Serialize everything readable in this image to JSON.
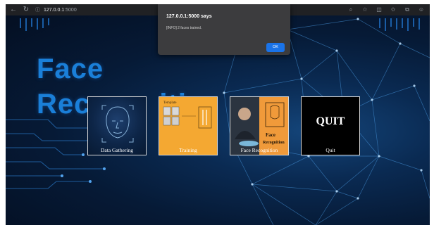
{
  "browser": {
    "url_host": "127.0.0.1",
    "url_port": ":5000",
    "nav": {
      "back": "←",
      "reload": "↻",
      "info": "ⓘ"
    }
  },
  "page": {
    "title_line1": "Face",
    "title_line2": "Rec",
    "title_line2_tail": "iti",
    "cards": [
      {
        "label": "Data Gathering"
      },
      {
        "label": "Training",
        "tag": "Template"
      },
      {
        "label": "Face Recognition"
      },
      {
        "label": "Quit",
        "heading": "QUIT"
      }
    ]
  },
  "dialog": {
    "title": "127.0.0.1:5000 says",
    "message": "[INFO] 2 faces trained.",
    "ok_label": "OK"
  },
  "colors": {
    "accent": "#1a73e8",
    "title": "#1a7fd8",
    "background": "#061a36"
  }
}
